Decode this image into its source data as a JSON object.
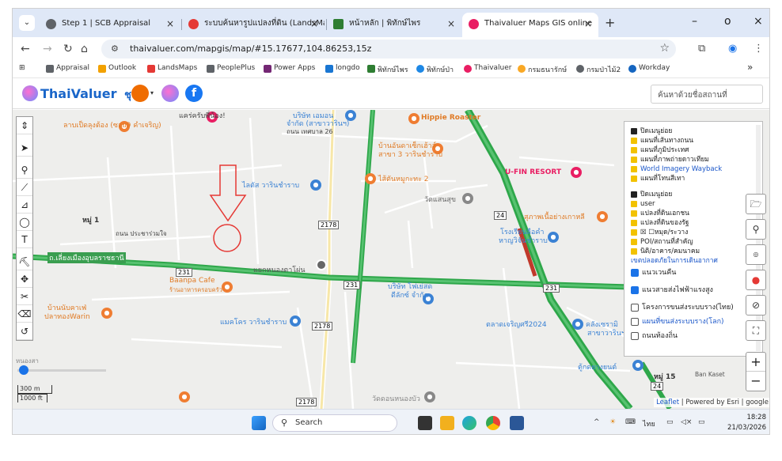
{
  "tabs": [
    {
      "label": "Step 1 | SCB Appraisal",
      "close": "×"
    },
    {
      "label": "ระบบค้นหารูปแปลงที่ดิน (LandsMap",
      "close": "×"
    },
    {
      "label": "หน้าหลัก | พิทักษ์ไพร",
      "close": "×"
    },
    {
      "label": "Thaivaluer Maps GIS online",
      "close": "×"
    }
  ],
  "tab_menu": "⌄",
  "new_tab": "+",
  "window_controls": {
    "minimize": "–",
    "maximize": "o",
    "close": "×"
  },
  "address": {
    "url": "thaivaluer.com/mapgis/map/#15.17677,104.86253,15z"
  },
  "bookmarks": [
    {
      "label": "Appraisal",
      "color": "#5f6368"
    },
    {
      "label": "Outlook",
      "color": "#f2a100"
    },
    {
      "label": "LandsMaps",
      "color": "#e53935"
    },
    {
      "label": "PeoplePlus",
      "color": "#5f6368"
    },
    {
      "label": "Power Apps",
      "color": "#742774"
    },
    {
      "label": "longdo",
      "color": "#1976d2"
    },
    {
      "label": "พิทักษ์ไพร",
      "color": "#2e7d32"
    },
    {
      "label": "พิทักษ์ป่า",
      "color": "#1e88e5"
    },
    {
      "label": "Thaivaluer",
      "color": "#e91e63"
    },
    {
      "label": "กรมธนารักษ์",
      "color": "#f9a825"
    },
    {
      "label": "กรมป่าไม้2",
      "color": "#5f6368"
    },
    {
      "label": "Workday",
      "color": "#1565c0"
    }
  ],
  "bookmarks_more": "»",
  "site": {
    "logo_text": "ThaiValuer",
    "logo_suffix": "ชุ",
    "search_placeholder": "ค้นหาด้วยชื่อสถานที่"
  },
  "map": {
    "place_labels": [
      "ลาบเป็ดลุงต้อง (ซอย9 คำเจริญ)",
      "แคร่ครับพี่น้อง!",
      "บริษัท เอมอน",
      "จำกัด (สาขาวารินฯ)",
      "ถนน เทศบาล 26",
      "Hippie Roaster",
      "บ้านอันดาเซ็กเฮ้าส์",
      "สาขา 3 วารินชำราบ",
      "ไส้ตันหมูกะทะ 2",
      "ไลตัส วารินชำราบ",
      "U-FIN RESORT",
      "วัดแสนสุข",
      "หมู่ 1",
      "ถนน ประชาร่วมใจ",
      "สุภาพเนื้อย่างเกาหลี",
      "โรงเรียนลือคำ",
      "หาญวิจันชำราบ",
      "ถ.เลี่ยงเมืองอุบลราชธานี",
      "แยกหนองตาโผ่น",
      "Baanpa Cafe",
      "ร้านอาหารครอบครัว",
      "บริษัท โฟเย่สด",
      "ดีลักซ์ จำกัด",
      "บ้านนับคาเฟ่",
      "ปลาทองWarin",
      "แมคโคร วารินชำราบ",
      "ตลาดเจริญศรี2024",
      "คลังเซรามิ",
      "สาขาวารินฯ",
      "หนองสา",
      "วัดดอนหนองบัว",
      "ตู้กดยางยนต์",
      "หมู่ 15",
      "Ban Kaset",
      "เขตปลอดภัยการบิน"
    ],
    "road_shields": [
      "231",
      "231",
      "231",
      "2178",
      "2178",
      "2178",
      "24",
      "24"
    ],
    "left_tools": [
      "up-down",
      "locate",
      "marker",
      "polyline",
      "ruler",
      "circle",
      "text",
      "hiking",
      "move",
      "scissors",
      "eraser",
      "undo"
    ],
    "layer_panel": {
      "group1_title": "ปิดเมนูย่อย",
      "group1_items": [
        "แผนที่เส้นทางถนน",
        "แผนที่ภูมิประเทศ",
        "แผนที่ภาพถ่ายดาวเทียม",
        "World Imagery Wayback",
        "แผนที่โทนสีเทา"
      ],
      "group2_title": "ปิดเมนูย่อย",
      "group2_items": [
        "user",
        "แปลงที่ดินเอกชน",
        "แปลงที่ดินของรัฐ",
        "☒ ☐หมุด/ระวาง",
        "POI/สถานที่สำคัญ",
        "นิติ/อาคาร/คมนาคม"
      ],
      "safe_zone": "เขตปลอดภัยในการเดินอากาศ",
      "checks": [
        {
          "label": "แนวเวนคืน",
          "checked": true
        },
        {
          "label": "แนวสายส่งไฟฟ้าแรงสูง",
          "checked": true
        },
        {
          "label": "โครงการขนส่งระบบราง(ไทย)",
          "checked": false
        },
        {
          "label": "แผนที่ขนส่งระบบราง(โลก)",
          "checked": false
        },
        {
          "label": "ถนนท้องถิ่น",
          "checked": false
        }
      ]
    },
    "right_tools": [
      "folder-open",
      "map-pin-outline",
      "street-view",
      "location-marker",
      "satellite-off",
      "fullscreen"
    ],
    "zoom": {
      "in": "+",
      "out": "−"
    },
    "scale": [
      "300 m",
      "1000 ft"
    ],
    "attribution": {
      "leaflet": "Leaflet",
      "rest": " | Powered by Esri | google"
    }
  },
  "taskbar": {
    "search_label": "Search",
    "tray_lang": "ไทย",
    "time": "18:28",
    "date": "21/03/2026"
  }
}
